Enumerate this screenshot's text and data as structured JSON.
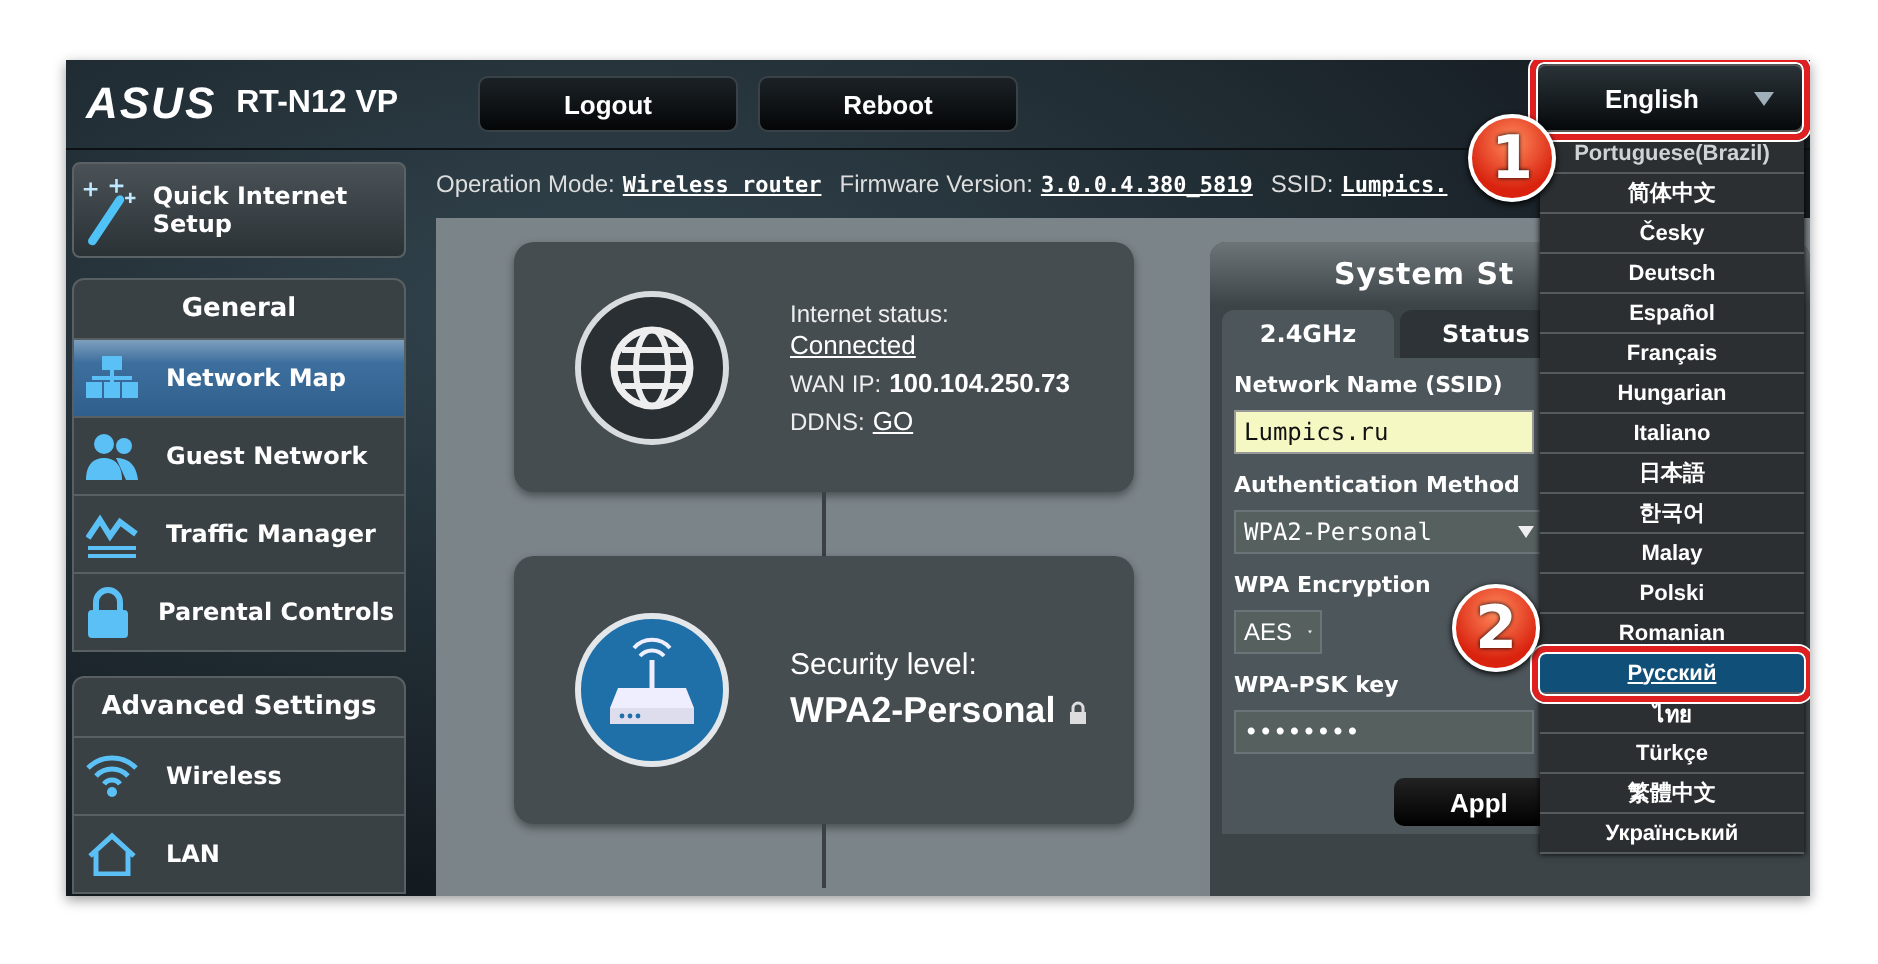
{
  "header": {
    "brand": "ASUS",
    "model": "RT-N12 VP",
    "buttons": [
      "Logout",
      "Reboot"
    ],
    "language": {
      "value": "English",
      "expanded": true
    }
  },
  "info_bar": [
    {
      "label": "Operation Mode:",
      "value": "Wireless router"
    },
    {
      "label": "Firmware Version:",
      "value": "3.0.0.4.380_5819"
    },
    {
      "label": "SSID:",
      "value": "Lumpics."
    }
  ],
  "sidebar": {
    "quick_setup": "Quick Internet Setup",
    "groups": [
      {
        "title": "General",
        "items": [
          {
            "label": "Network Map",
            "selected": true
          },
          {
            "label": "Guest Network",
            "selected": false
          },
          {
            "label": "Traffic Manager",
            "selected": false
          },
          {
            "label": "Parental Controls",
            "selected": false
          }
        ]
      },
      {
        "title": "Advanced Settings",
        "items": [
          {
            "label": "Wireless",
            "selected": false
          },
          {
            "label": "LAN",
            "selected": false
          }
        ]
      }
    ]
  },
  "network_map": {
    "internet": {
      "status_label": "Internet status:",
      "status": "Connected",
      "wan_label": "WAN IP:",
      "wan_ip": "100.104.250.73",
      "ddns_label": "DDNS:",
      "ddns": "GO"
    },
    "security": {
      "label": "Security level:",
      "value": "WPA2-Personal"
    }
  },
  "system_status": {
    "title": "System St",
    "tabs": [
      {
        "label": "2.4GHz",
        "selected": true
      },
      {
        "label": "Status",
        "selected": false
      }
    ],
    "fields": [
      {
        "kind": "text",
        "label": "Network Name (SSID)",
        "value": "Lumpics.ru"
      },
      {
        "kind": "select",
        "label": "Authentication Method",
        "value": "WPA2-Personal"
      },
      {
        "kind": "select-small",
        "label": "WPA Encryption",
        "value": "AES"
      },
      {
        "kind": "password",
        "label": "WPA-PSK key",
        "value": "••••••••"
      }
    ],
    "apply": "Appl"
  },
  "language_menu": [
    {
      "label": "Portuguese(Brazil)",
      "selected": false
    },
    {
      "label": "简体中文",
      "selected": false
    },
    {
      "label": "Česky",
      "selected": false
    },
    {
      "label": "Deutsch",
      "selected": false
    },
    {
      "label": "Español",
      "selected": false
    },
    {
      "label": "Français",
      "selected": false
    },
    {
      "label": "Hungarian",
      "selected": false
    },
    {
      "label": "Italiano",
      "selected": false
    },
    {
      "label": "日本語",
      "selected": false
    },
    {
      "label": "한국어",
      "selected": false
    },
    {
      "label": "Malay",
      "selected": false
    },
    {
      "label": "Polski",
      "selected": false
    },
    {
      "label": "Romanian",
      "selected": false
    },
    {
      "label": "Русский",
      "selected": true
    },
    {
      "label": "ไทย",
      "selected": false
    },
    {
      "label": "Türkçe",
      "selected": false
    },
    {
      "label": "繁體中文",
      "selected": false
    },
    {
      "label": "Український",
      "selected": false
    }
  ],
  "callouts": [
    "1",
    "2"
  ]
}
